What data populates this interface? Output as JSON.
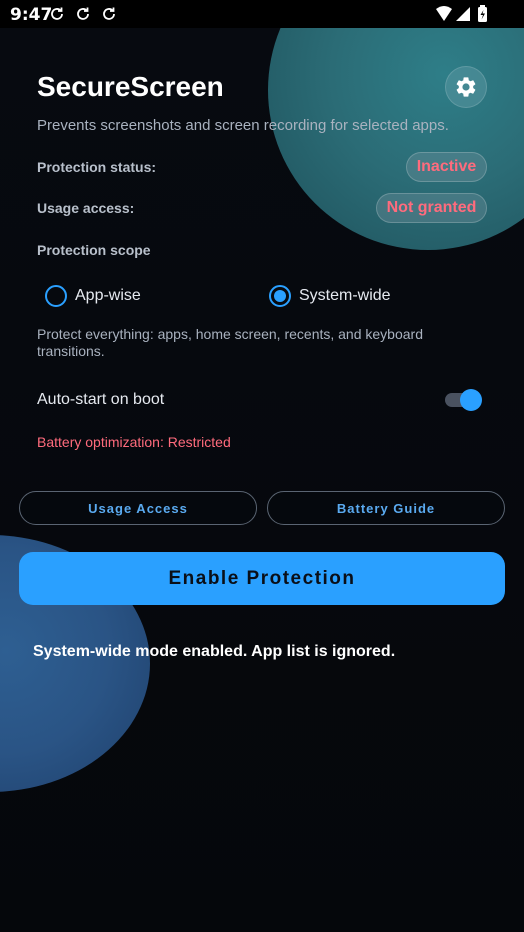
{
  "status_bar": {
    "time": "9:47"
  },
  "header": {
    "title": "SecureScreen",
    "subtitle": "Prevents screenshots and screen recording for selected apps."
  },
  "status": {
    "protection_label": "Protection status:",
    "protection_value": "Inactive",
    "usage_label": "Usage access:",
    "usage_value": "Not granted"
  },
  "scope": {
    "label": "Protection scope",
    "options": [
      {
        "label": "App-wise",
        "selected": false
      },
      {
        "label": "System-wide",
        "selected": true
      }
    ],
    "description": "Protect everything: apps, home screen, recents, and keyboard transitions."
  },
  "autostart": {
    "label": "Auto-start on boot",
    "enabled": true,
    "battery_note": "Battery optimization: Restricted"
  },
  "buttons": {
    "usage_access": "Usage Access",
    "battery_guide": "Battery Guide",
    "enable_protection": "Enable Protection"
  },
  "footer": {
    "mode_note": "System-wide mode enabled. App list is ignored."
  },
  "colors": {
    "accent": "#2aa0ff",
    "warning": "#ff6b7d",
    "background": "#05070b"
  },
  "icons": {
    "settings": "gear-icon",
    "sync": "sync-icon",
    "wifi": "wifi-icon",
    "signal": "signal-icon",
    "battery": "battery-icon"
  }
}
